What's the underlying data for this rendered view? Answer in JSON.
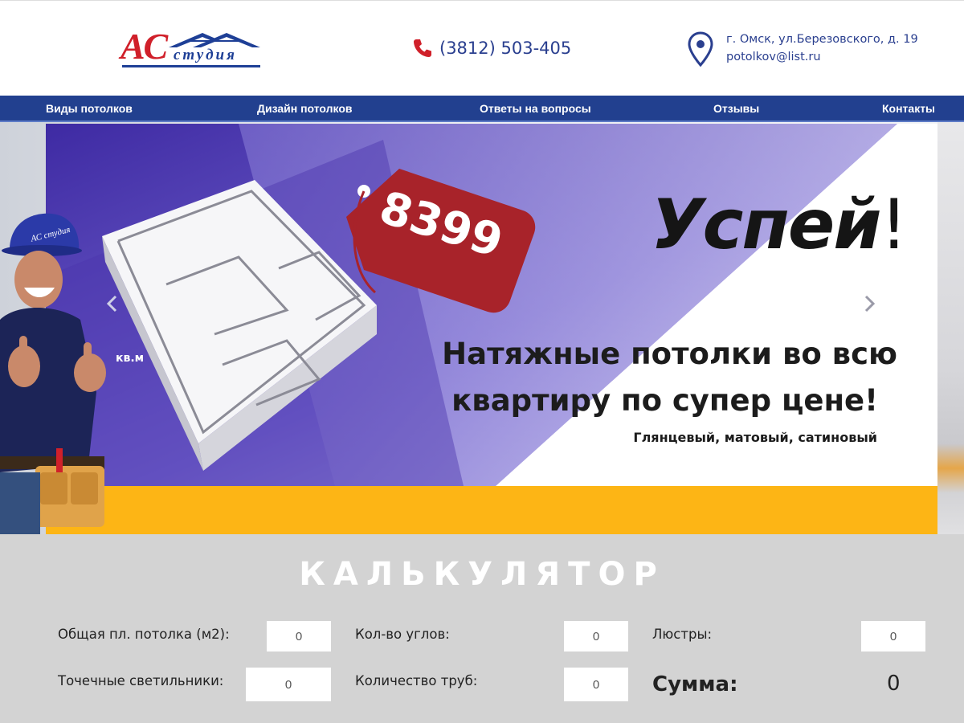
{
  "header": {
    "logo_main": "АС",
    "logo_sub": "студия",
    "phone": "(3812) 503-405",
    "address": "г. Омск, ул.Березовского, д. 19",
    "email": "potolkov@list.ru"
  },
  "nav": {
    "items": [
      {
        "label": "Виды потолков"
      },
      {
        "label": "Дизайн потолков"
      },
      {
        "label": "Ответы на вопросы"
      },
      {
        "label": "Отзывы"
      },
      {
        "label": "Контакты"
      }
    ]
  },
  "banner": {
    "price": "8399",
    "unit": "кв.м",
    "title": "Успей",
    "title_mark": "!",
    "headline_1": "Натяжные потолки во всю",
    "headline_2": "квартиру по супер цене!",
    "subline": "Глянцевый, матовый, сатиновый",
    "hardhat_text": "АС студия",
    "colors": {
      "purple": "#5b48b8",
      "price_tag": "#a8232a",
      "yellow": "#fdb515"
    }
  },
  "calculator": {
    "title": "КАЛЬКУЛЯТОР",
    "fields": [
      {
        "label": "Общая пл. потолка (м2):",
        "value": "0"
      },
      {
        "label": "Кол-во углов:",
        "value": "0"
      },
      {
        "label": "Люстры:",
        "value": "0"
      },
      {
        "label": "Точечные светильники:",
        "value": "0"
      },
      {
        "label": "Количество труб:",
        "value": "0"
      }
    ],
    "sum_label": "Сумма:",
    "sum_value": "0"
  }
}
